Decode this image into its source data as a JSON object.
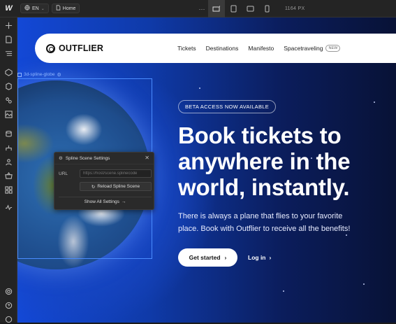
{
  "toolbar": {
    "app_logo": "W",
    "locale": "EN",
    "page": "Home",
    "more": "···",
    "width_readout": "1164 PX"
  },
  "sidebar": {
    "icons": [
      "add-icon",
      "pages-icon",
      "navigator-icon",
      "components-icon",
      "cms-icon",
      "assets-icon",
      "apps-icon",
      "database-icon",
      "logic-icon",
      "users-icon",
      "ecommerce-icon",
      "integrations-icon",
      "analytics-icon",
      "settings-icon",
      "help-icon",
      "avatar-icon"
    ]
  },
  "site": {
    "brand": "OUTFLIER",
    "nav": [
      "Tickets",
      "Destinations",
      "Manifesto",
      "Spacetraveling"
    ],
    "nav_badge": "NEW",
    "beta": "BETA ACCESS NOW AVAILABLE",
    "headline": [
      "Book tickets to",
      "anywhere in the",
      "world, instantly."
    ],
    "subtext": [
      "There is always a plane that flies to your favorite",
      "place. Book with Outflier to receive all the benefits!"
    ],
    "cta_primary": "Get started",
    "cta_secondary": "Log in"
  },
  "element_tag": "3d-spline-globe",
  "panel": {
    "title": "Spline Scene Settings",
    "url_label": "URL",
    "url_placeholder": "https://host/scene.splinecode",
    "reload": "Reload Spline Scene",
    "show_all": "Show All Settings"
  },
  "colors": {
    "accent": "#4a8cff",
    "canvas_blue": "#1348d6",
    "panel_bg": "#2a2a2a"
  }
}
